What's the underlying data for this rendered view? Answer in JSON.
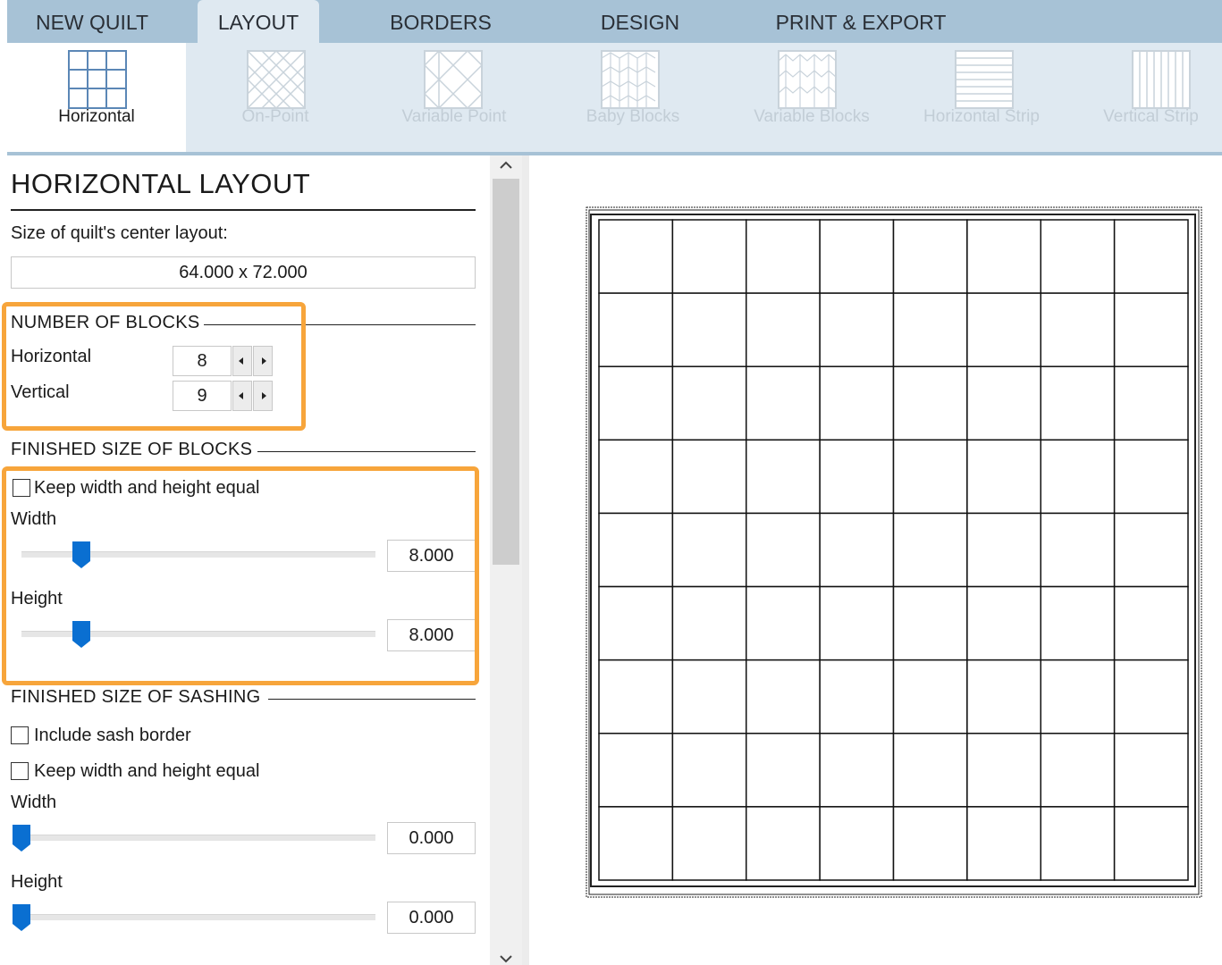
{
  "tabs": [
    {
      "label": "NEW QUILT"
    },
    {
      "label": "LAYOUT"
    },
    {
      "label": "BORDERS"
    },
    {
      "label": "DESIGN"
    },
    {
      "label": "PRINT & EXPORT"
    }
  ],
  "ribbon": [
    {
      "label": "Horizontal",
      "icon": "horizontal-grid-icon",
      "state": "selected"
    },
    {
      "label": "On-Point",
      "icon": "on-point-grid-icon",
      "state": "disabled"
    },
    {
      "label": "Variable Point",
      "icon": "variable-point-grid-icon",
      "state": "disabled"
    },
    {
      "label": "Baby Blocks",
      "icon": "baby-blocks-icon",
      "state": "disabled"
    },
    {
      "label": "Variable Blocks",
      "icon": "variable-blocks-icon",
      "state": "disabled"
    },
    {
      "label": "Horizontal Strip",
      "icon": "horizontal-strip-icon",
      "state": "disabled"
    },
    {
      "label": "Vertical Strip",
      "icon": "vertical-strip-icon",
      "state": "disabled"
    }
  ],
  "panel": {
    "title": "HORIZONTAL LAYOUT",
    "size_label": "Size of quilt's center layout:",
    "size_value": "64.000 x 72.000",
    "blocks": {
      "heading": "NUMBER OF BLOCKS",
      "horizontal_label": "Horizontal",
      "horizontal_value": "8",
      "vertical_label": "Vertical",
      "vertical_value": "9"
    },
    "finished": {
      "heading": "FINISHED SIZE OF BLOCKS",
      "keep_equal": "Keep width and height equal",
      "keep_equal_checked": false,
      "width_label": "Width",
      "width_value": "8.000",
      "width_slider_fraction": 0.17,
      "height_label": "Height",
      "height_value": "8.000",
      "height_slider_fraction": 0.17
    },
    "sashing": {
      "heading": "FINISHED SIZE OF SASHING",
      "include_border": "Include sash border",
      "include_border_checked": false,
      "keep_equal": "Keep width and height equal",
      "keep_equal_checked": false,
      "width_label": "Width",
      "width_value": "0.000",
      "width_slider_fraction": 0,
      "height_label": "Height",
      "height_value": "0.000",
      "height_slider_fraction": 0
    }
  },
  "quilt": {
    "columns": 8,
    "rows": 9
  },
  "colors": {
    "tabbar": "#a7c2d6",
    "ribbon": "#dfe9f1",
    "highlight": "#f7a53b",
    "slider_thumb": "#0a6fd1"
  }
}
